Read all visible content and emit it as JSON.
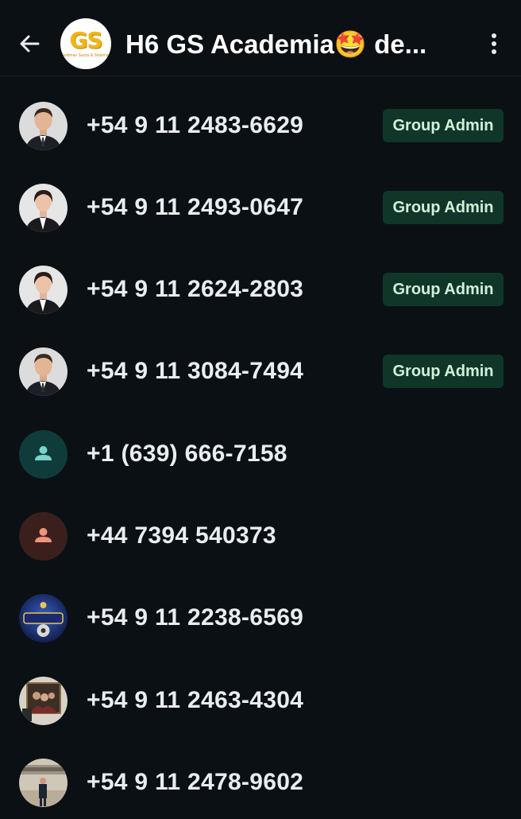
{
  "header": {
    "back_icon": "arrow-left-icon",
    "group_avatar_text": "GS",
    "group_avatar_subtext": "Goldman Sachs & Sistemas",
    "title": "H6 GS Academia🤩 de...",
    "menu_icon": "more-vertical-icon"
  },
  "badge_color": "#103629",
  "members": [
    {
      "phone": "+54 9 11 2483-6629",
      "badge": "Group Admin",
      "avatar": "man-suit-photo"
    },
    {
      "phone": "+54 9 11 2493-0647",
      "badge": "Group Admin",
      "avatar": "woman-suit-photo"
    },
    {
      "phone": "+54 9 11 2624-2803",
      "badge": "Group Admin",
      "avatar": "woman-suit-photo"
    },
    {
      "phone": "+54 9 11 3084-7494",
      "badge": "Group Admin",
      "avatar": "man-suit-photo"
    },
    {
      "phone": "+1 (639) 666-7158",
      "badge": "",
      "avatar": "default-person-teal-icon"
    },
    {
      "phone": "+44 7394 540373",
      "badge": "",
      "avatar": "default-person-orange-icon"
    },
    {
      "phone": "+54 9 11 2238-6569",
      "badge": "",
      "avatar": "carlos-logo-photo"
    },
    {
      "phone": "+54 9 11 2463-4304",
      "badge": "",
      "avatar": "group-framed-photo"
    },
    {
      "phone": "+54 9 11 2478-9602",
      "badge": "",
      "avatar": "harvard-photo"
    }
  ]
}
